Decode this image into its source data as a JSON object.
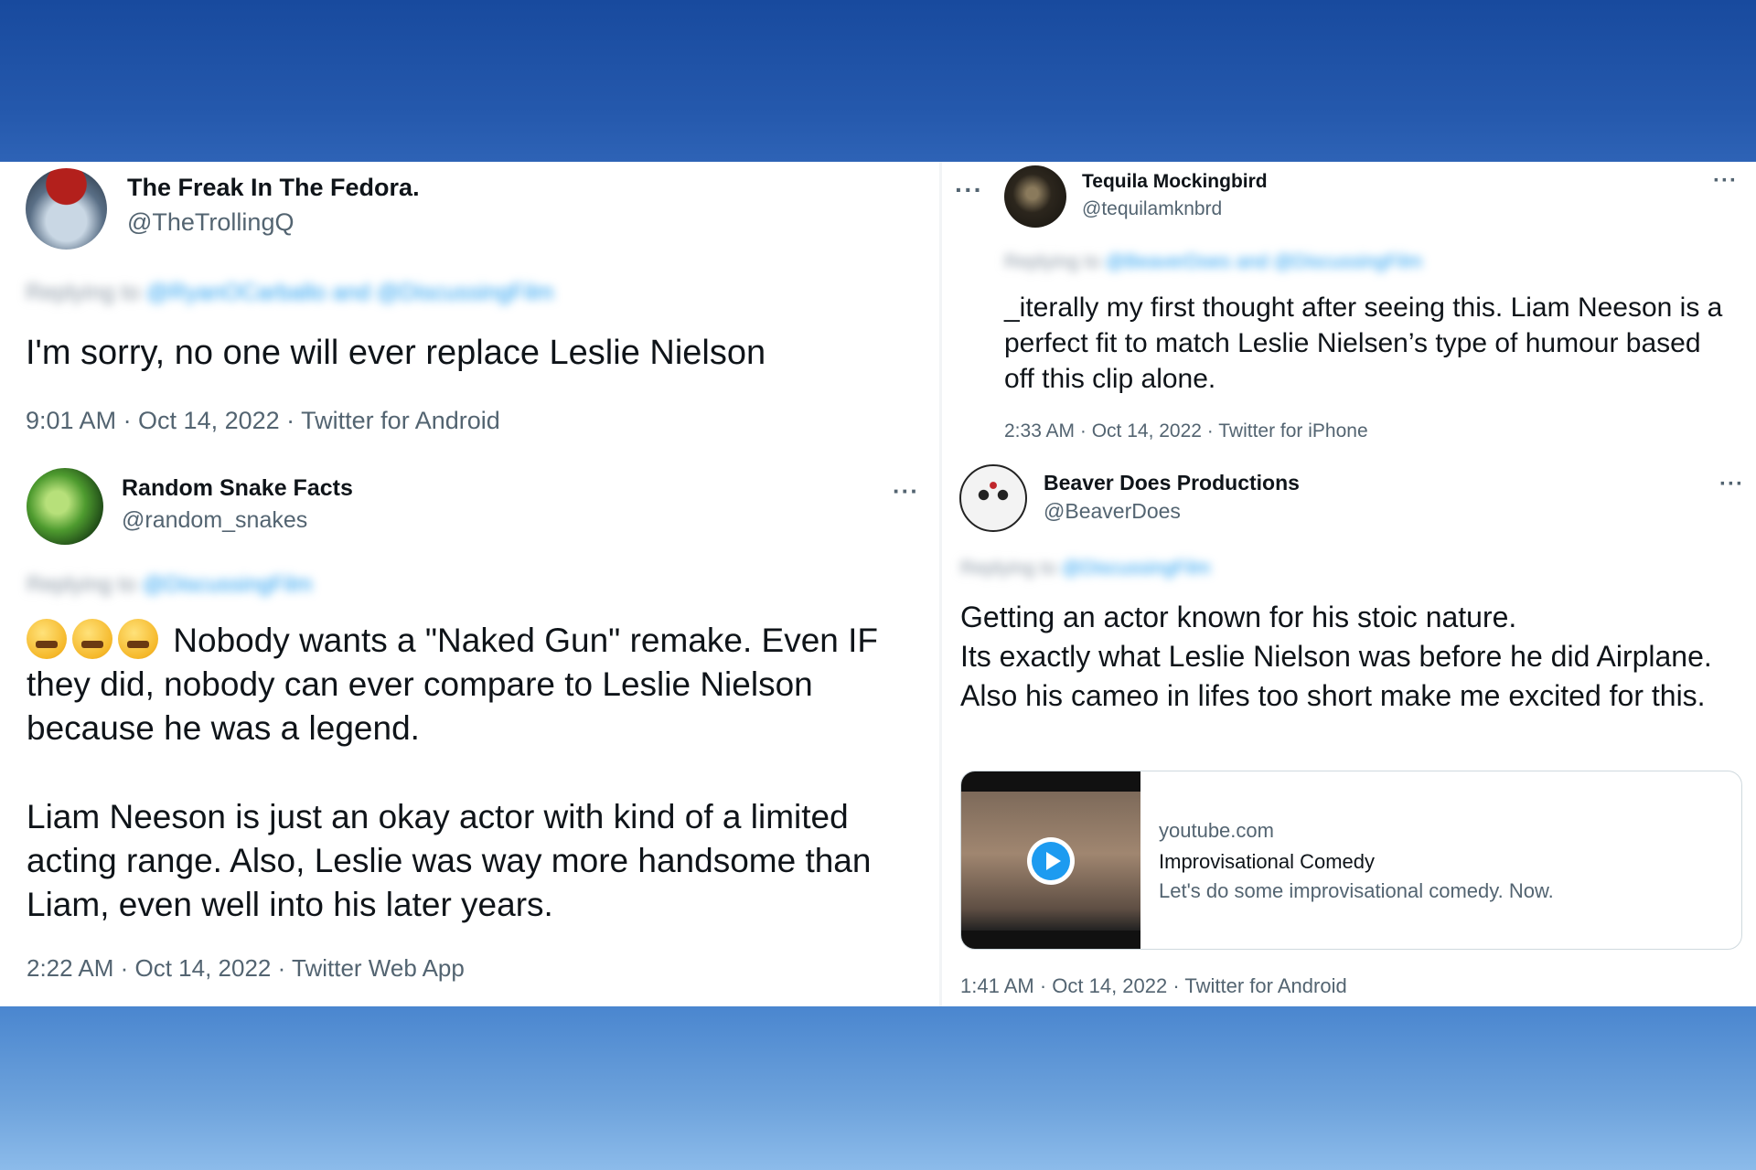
{
  "tweets": [
    {
      "name": "The Freak In The Fedora.",
      "handle": "@TheTrollingQ",
      "replying_prefix": "Replying to",
      "replying_mentions": "@RyanOCarballo and @DiscussingFilm",
      "text": "I'm sorry, no one will ever replace Leslie Nielson",
      "meta": "9:01 AM · Oct 14, 2022 · Twitter for Android",
      "more": "···"
    },
    {
      "name": "Tequila Mockingbird",
      "handle": "@tequilamknbrd",
      "replying_prefix": "Replying to",
      "replying_mentions": "@BeaverDoes and @DiscussingFilm",
      "text": "_iterally my first thought after seeing this. Liam Neeson is a perfect fit to match Leslie Nielsen’s type of humour based off this clip alone.",
      "meta": "2:33 AM · Oct 14, 2022 · Twitter for iPhone",
      "more": "···"
    },
    {
      "name": "Random Snake Facts",
      "handle": "@random_snakes",
      "replying_prefix": "Replying to",
      "replying_mentions": "@DiscussingFilm",
      "text_p1": "Nobody wants a \"Naked Gun\" remake. Even IF they did, nobody can ever compare to Leslie Nielson because he was a legend.",
      "text_p2": "Liam Neeson is just an okay actor with kind of a limited acting range. Also, Leslie was way more handsome than Liam, even well into his later years.",
      "meta": "2:22 AM · Oct 14, 2022 · Twitter Web App",
      "more": "···"
    },
    {
      "name": "Beaver Does Productions",
      "handle": "@BeaverDoes",
      "replying_prefix": "Replying to",
      "replying_mentions": "@DiscussingFilm",
      "text": "Getting an actor known for his stoic nature.\nIts exactly what Leslie Nielson was before he did Airplane. Also his cameo in lifes too short make me excited for this.",
      "card": {
        "domain": "youtube.com",
        "title": "Improvisational Comedy",
        "description": "Let's do some improvisational comedy. Now."
      },
      "meta": "1:41 AM · Oct 14, 2022 · Twitter for Android",
      "more": "···"
    }
  ],
  "colors": {
    "background_top": "#1b4fa3",
    "background_bottom": "#86b5e6",
    "text_primary": "#0f1419",
    "text_secondary": "#536471",
    "link": "#1d9bf0"
  }
}
